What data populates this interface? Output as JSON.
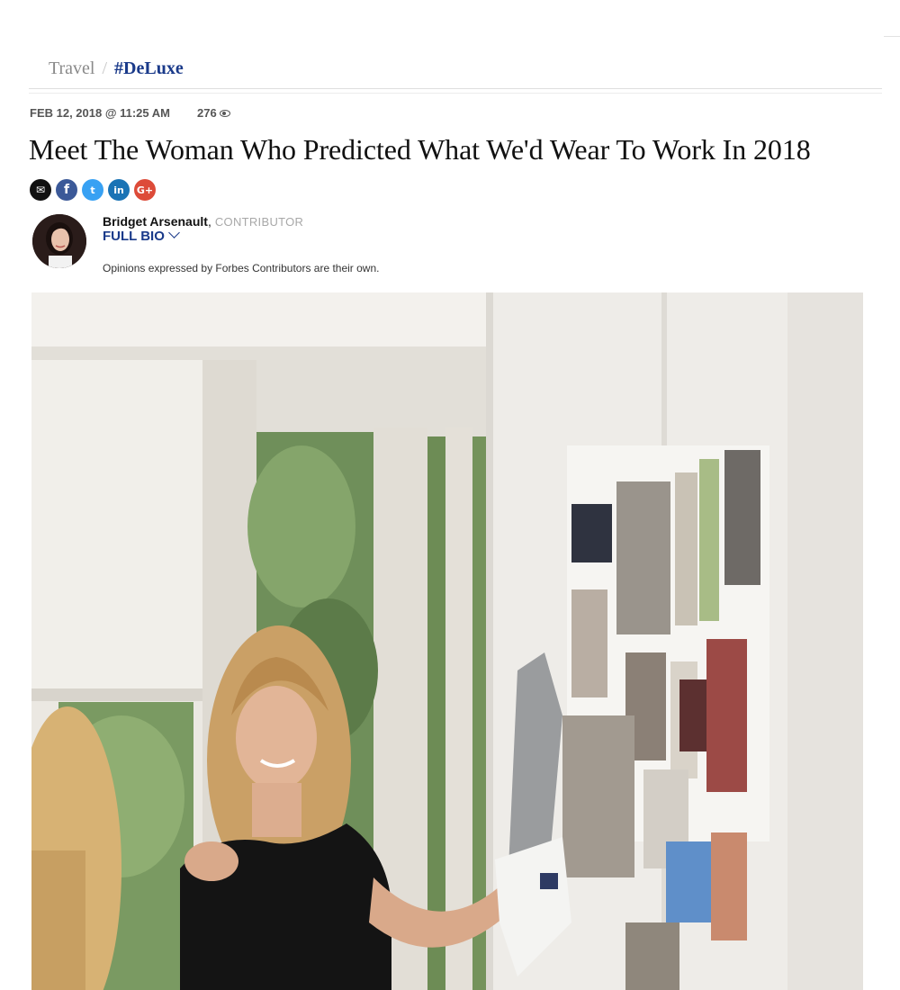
{
  "breadcrumb": {
    "channel": "Travel",
    "separator": "/",
    "section": "#DeLuxe"
  },
  "article": {
    "date": "FEB 12, 2018 @ 11:25 AM",
    "views": "276",
    "headline": "Meet The Woman Who Predicted What We'd Wear To Work In 2018"
  },
  "share": {
    "email_glyph": "✉",
    "facebook_glyph": "f",
    "twitter_glyph": "t",
    "linkedin_glyph": "in",
    "google_glyph": "G+"
  },
  "author": {
    "name": "Bridget Arsenault",
    "comma": ",",
    "role": "CONTRIBUTOR",
    "bio_link": "FULL BIO",
    "disclaimer": "Opinions expressed by Forbes Contributors are their own."
  },
  "icons": {
    "views": "eye-icon",
    "bio": "chevron-down-icon"
  },
  "colors": {
    "section_link": "#1a3a8a",
    "facebook": "#3b5998",
    "twitter": "#38a1f3",
    "linkedin": "#1a73b5",
    "google": "#dd4b39"
  }
}
